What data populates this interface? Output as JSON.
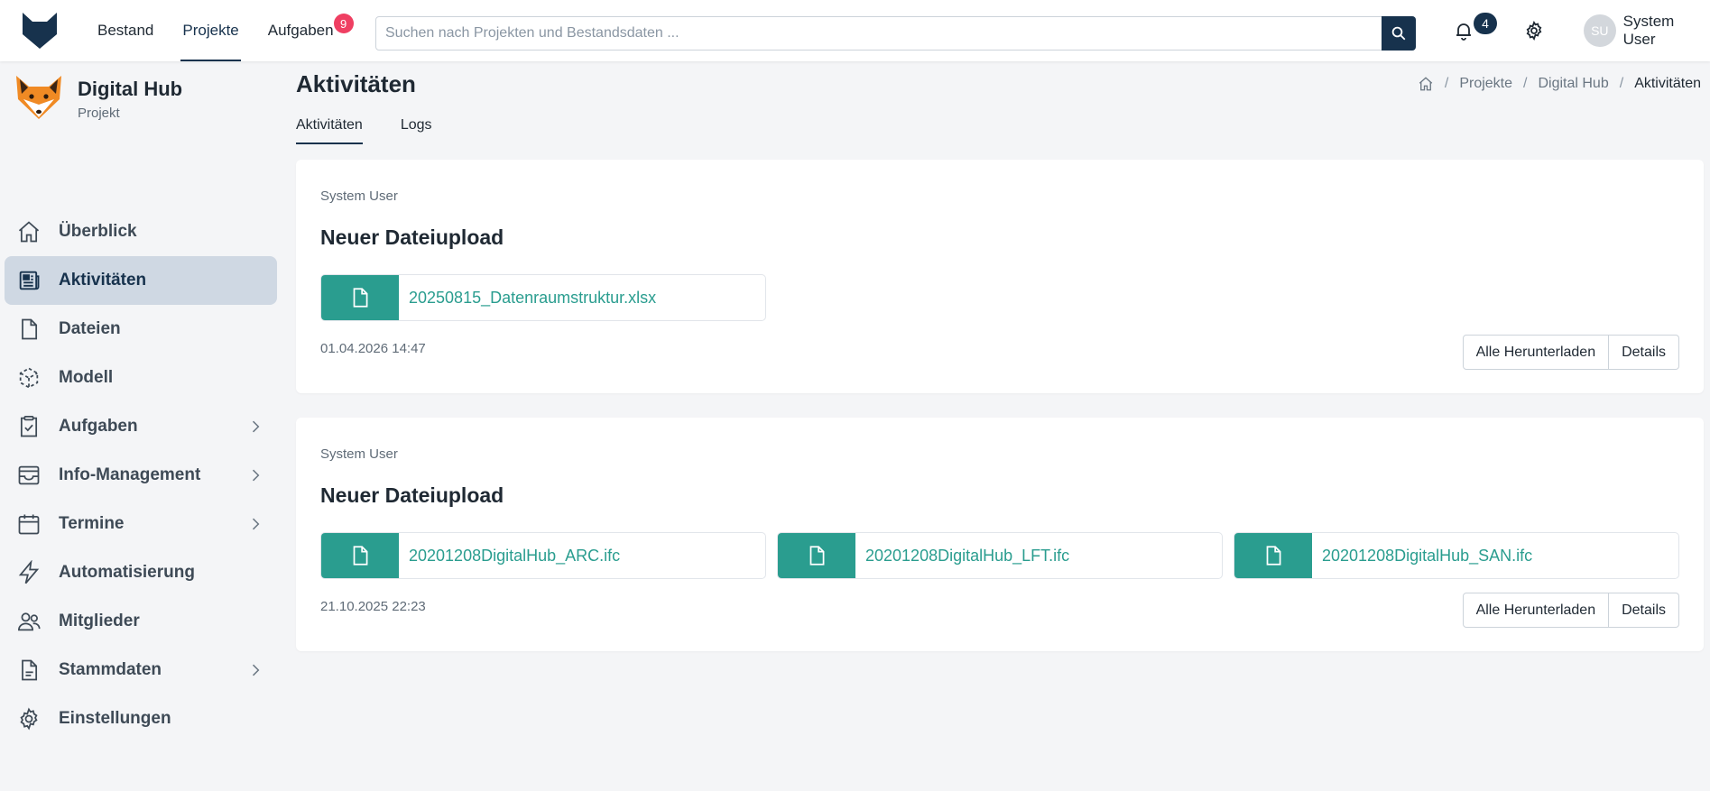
{
  "topnav": {
    "items": [
      "Bestand",
      "Projekte",
      "Aufgaben"
    ],
    "active_index": 1,
    "tasks_badge": "9"
  },
  "search": {
    "placeholder": "Suchen nach Projekten und Bestandsdaten ..."
  },
  "notifications": {
    "count": "4"
  },
  "user": {
    "initials": "SU",
    "name": "System User"
  },
  "project": {
    "title": "Digital Hub",
    "subtitle": "Projekt"
  },
  "sidebar": {
    "items": [
      {
        "label": "Überblick",
        "icon": "home-icon",
        "chevron": false
      },
      {
        "label": "Aktivitäten",
        "icon": "newspaper-icon",
        "chevron": false,
        "active": true
      },
      {
        "label": "Dateien",
        "icon": "file-icon",
        "chevron": false
      },
      {
        "label": "Modell",
        "icon": "cube-icon",
        "chevron": false
      },
      {
        "label": "Aufgaben",
        "icon": "clipboard-check-icon",
        "chevron": true
      },
      {
        "label": "Info-Management",
        "icon": "inbox-icon",
        "chevron": true
      },
      {
        "label": "Termine",
        "icon": "calendar-icon",
        "chevron": true
      },
      {
        "label": "Automatisierung",
        "icon": "lightning-icon",
        "chevron": false
      },
      {
        "label": "Mitglieder",
        "icon": "users-icon",
        "chevron": false
      },
      {
        "label": "Stammdaten",
        "icon": "document-text-icon",
        "chevron": true
      },
      {
        "label": "Einstellungen",
        "icon": "gear-icon",
        "chevron": false
      }
    ]
  },
  "main": {
    "title": "Aktivitäten",
    "breadcrumb": [
      "Projekte",
      "Digital Hub",
      "Aktivitäten"
    ],
    "tabs": [
      "Aktivitäten",
      "Logs"
    ],
    "activities": [
      {
        "user": "System User",
        "title": "Neuer Dateiupload",
        "files": [
          "20250815_Datenraumstruktur.xlsx"
        ],
        "date": "01.04.2026 14:47",
        "download_label": "Alle Herunterladen",
        "details_label": "Details"
      },
      {
        "user": "System User",
        "title": "Neuer Dateiupload",
        "files": [
          "20201208DigitalHub_ARC.ifc",
          "20201208DigitalHub_LFT.ifc",
          "20201208DigitalHub_SAN.ifc"
        ],
        "date": "21.10.2025 22:23",
        "download_label": "Alle Herunterladen",
        "details_label": "Details"
      }
    ]
  },
  "colors": {
    "primary": "#17324d",
    "accent": "#2a9d8f",
    "badge": "#ef3f62",
    "active_bg": "#cfd8e3"
  }
}
